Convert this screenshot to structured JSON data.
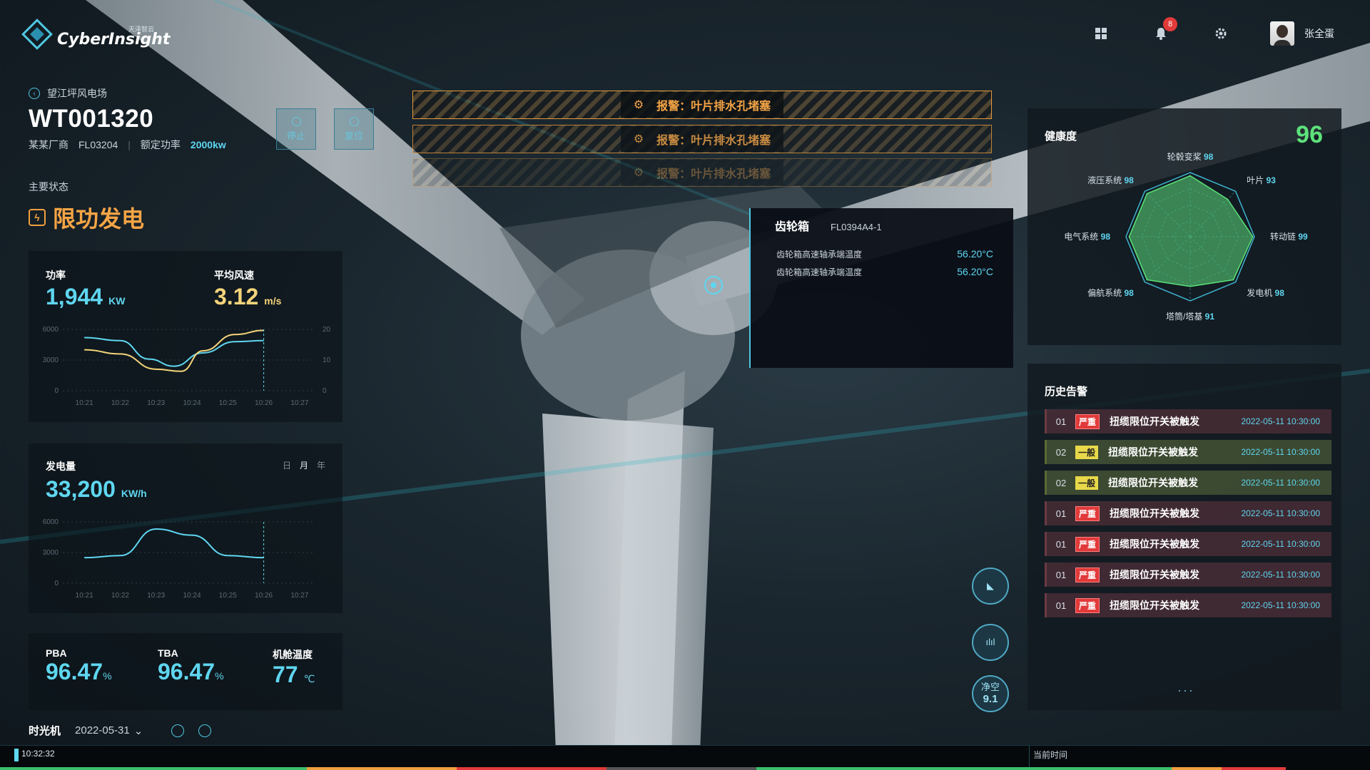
{
  "app": {
    "logo_text": "CyberInsight",
    "logo_sub": "天泽智云",
    "user_name": "张全蛋",
    "notification_count": "8"
  },
  "site": {
    "breadcrumb": "望江坪风电场",
    "turbine_id": "WT001320",
    "manufacturer": "某某厂商",
    "model": "FL03204",
    "rated_label": "额定功率",
    "rated_value": "2000kw"
  },
  "controls": {
    "stop": "停止",
    "reset": "复位"
  },
  "status": {
    "label": "主要状态",
    "value": "限功发电",
    "color": "#f5a445"
  },
  "power": {
    "power_label": "功率",
    "power_value": "1,944",
    "power_unit": "KW",
    "wind_label": "平均风速",
    "wind_value": "3.12",
    "wind_unit": "m/s",
    "chart_data": {
      "type": "line",
      "x": [
        "10:21",
        "10:22",
        "10:23",
        "10:24",
        "10:25",
        "10:26",
        "10:27"
      ],
      "ylim": [
        0,
        6000
      ],
      "yticks": [
        "6000",
        "3000",
        "0"
      ],
      "y2lim": [
        0,
        20
      ],
      "y2ticks": [
        "20",
        "10",
        "0"
      ],
      "series": [
        {
          "color": "#5fd6f0",
          "axis": "left",
          "values": [
            [
              0,
              5200
            ],
            [
              1,
              4900
            ],
            [
              1.8,
              3100
            ],
            [
              2.5,
              2400
            ],
            [
              3.3,
              3700
            ],
            [
              4.2,
              4800
            ],
            [
              5,
              4900
            ]
          ]
        },
        {
          "color": "#f5d47a",
          "axis": "left",
          "values": [
            [
              0,
              4000
            ],
            [
              1,
              3600
            ],
            [
              2,
              2100
            ],
            [
              2.7,
              1900
            ],
            [
              3.3,
              3900
            ],
            [
              4.2,
              5500
            ],
            [
              5,
              5900
            ]
          ]
        }
      ],
      "cursor_x": 5
    }
  },
  "energy": {
    "label": "发电量",
    "value": "33,200",
    "unit": "KW/h",
    "toggles": [
      "日",
      "月",
      "年"
    ],
    "active_toggle": "月",
    "chart_data": {
      "type": "line",
      "x": [
        "10:21",
        "10:22",
        "10:23",
        "10:24",
        "10:25",
        "10:26",
        "10:27"
      ],
      "ylim": [
        0,
        6000
      ],
      "yticks": [
        "6000",
        "3000",
        "0"
      ],
      "series": [
        {
          "color": "#5fd6f0",
          "values": [
            [
              0,
              2500
            ],
            [
              1,
              2700
            ],
            [
              2,
              5300
            ],
            [
              3,
              4700
            ],
            [
              4,
              2700
            ],
            [
              5,
              2500
            ]
          ]
        }
      ],
      "cursor_x": 5
    }
  },
  "stats": [
    {
      "label": "PBA",
      "value": "96.47",
      "unit": "%"
    },
    {
      "label": "TBA",
      "value": "96.47",
      "unit": "%"
    },
    {
      "label": "机舱温度",
      "value": "77",
      "unit": "℃"
    }
  ],
  "timeline": {
    "label": "时光机",
    "date": "2022-05-31",
    "current_time": "10:32:32",
    "now_label": "当前时间"
  },
  "alarms": [
    {
      "text": "报警：叶片排水孔堵塞"
    },
    {
      "text": "报警：叶片排水孔堵塞"
    },
    {
      "text": "报警：叶片排水孔堵塞"
    }
  ],
  "gearbox": {
    "title": "齿轮箱",
    "code": "FL0394A4-1",
    "rows": [
      {
        "label": "齿轮箱高速轴承端温度",
        "value": "56.20°C"
      },
      {
        "label": "齿轮箱高速轴承端温度",
        "value": "56.20°C"
      }
    ]
  },
  "health": {
    "title": "健康度",
    "score": "96",
    "chart_data": {
      "type": "radar",
      "axes": [
        "轮毂变桨",
        "叶片",
        "转动链",
        "发电机",
        "塔筒/塔基",
        "偏航系统",
        "电气系统",
        "液压系统"
      ],
      "values": [
        98,
        93,
        99,
        98,
        91,
        98,
        98,
        98
      ],
      "max": 100
    }
  },
  "history": {
    "title": "历史告警",
    "rows": [
      {
        "num": "01",
        "level": "严重",
        "type": "severe",
        "msg": "扭缆限位开关被触发",
        "ts": "2022-05-11  10:30:00"
      },
      {
        "num": "02",
        "level": "一般",
        "type": "normal",
        "msg": "扭缆限位开关被触发",
        "ts": "2022-05-11  10:30:00"
      },
      {
        "num": "02",
        "level": "一般",
        "type": "normal",
        "msg": "扭缆限位开关被触发",
        "ts": "2022-05-11  10:30:00"
      },
      {
        "num": "01",
        "level": "严重",
        "type": "severe",
        "msg": "扭缆限位开关被触发",
        "ts": "2022-05-11  10:30:00"
      },
      {
        "num": "01",
        "level": "严重",
        "type": "severe",
        "msg": "扭缆限位开关被触发",
        "ts": "2022-05-11  10:30:00"
      },
      {
        "num": "01",
        "level": "严重",
        "type": "severe",
        "msg": "扭缆限位开关被触发",
        "ts": "2022-05-11  10:30:00"
      },
      {
        "num": "01",
        "level": "严重",
        "type": "severe",
        "msg": "扭缆限位开关被触发",
        "ts": "2022-05-11  10:30:00"
      }
    ],
    "more": "···"
  },
  "side_buttons": {
    "clearance_label": "净空",
    "clearance_value": "9.1"
  }
}
